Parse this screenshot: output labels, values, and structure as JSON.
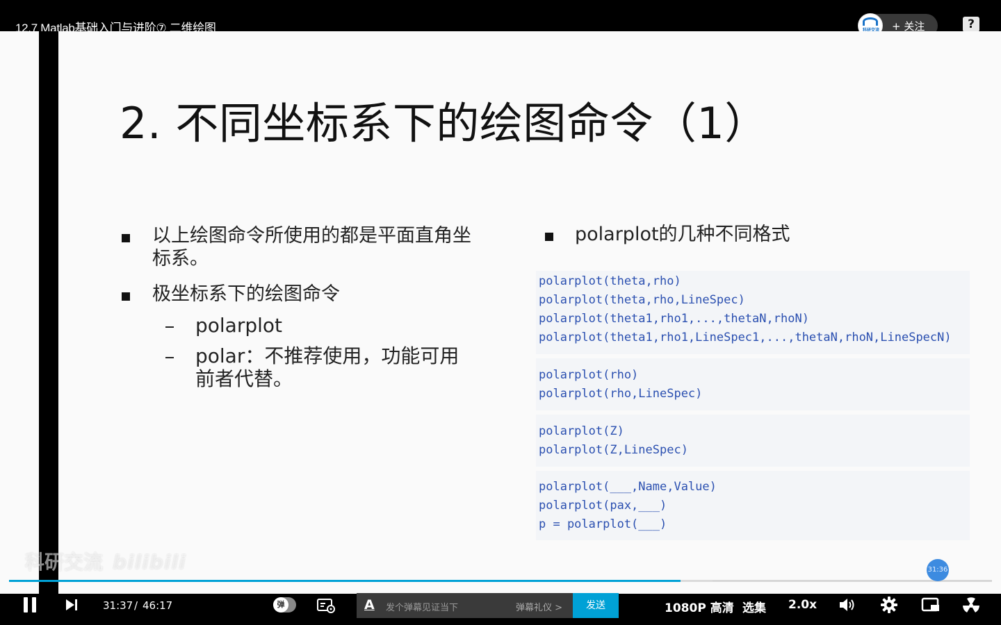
{
  "header": {
    "title": "12.7 Matlab基础入门与进阶⑦ 二维绘图",
    "follow_label": "+ 关注",
    "avatar_text": "科研交流",
    "help_label": "?"
  },
  "slide": {
    "title": "2. 不同坐标系下的绘图命令（1）",
    "left_bullets": [
      {
        "text": "以上绘图命令所使用的都是平面直角坐标系。"
      },
      {
        "text": "极坐标系下的绘图命令"
      }
    ],
    "sub_items": [
      {
        "text": "polarplot"
      },
      {
        "text": "polar：不推荐使用，功能可用前者代替。"
      }
    ],
    "right_bullet": "polarplot的几种不同格式",
    "code_lines": [
      "polarplot(theta,rho)",
      "polarplot(theta,rho,LineSpec)",
      "polarplot(theta1,rho1,...,thetaN,rhoN)",
      "polarplot(theta1,rho1,LineSpec1,...,thetaN,rhoN,LineSpecN)",
      "polarplot(rho)",
      "polarplot(rho,LineSpec)",
      "polarplot(Z)",
      "polarplot(Z,LineSpec)",
      "polarplot(___,Name,Value)",
      "polarplot(pax,___)",
      "p = polarplot(___)"
    ]
  },
  "watermark": {
    "channel": "科研交流",
    "brand": "bilibili"
  },
  "player": {
    "current_time": "31:37",
    "separator": "/",
    "total_time": "46:17",
    "seek_preview_time": "31:36",
    "progress_fraction": 0.683,
    "buffered_fraction": 0.716,
    "danmaku_toggle_label": "弹",
    "danmaku_placeholder": "发个弹幕见证当下",
    "danmaku_etiquette": "弹幕礼仪 >",
    "send_label": "发送",
    "quality_label": "1080P 高清",
    "episodes_label": "选集",
    "speed_label": "2.0x"
  },
  "colors": {
    "accent": "#00a1d6",
    "code_text": "#2a4fb0"
  }
}
